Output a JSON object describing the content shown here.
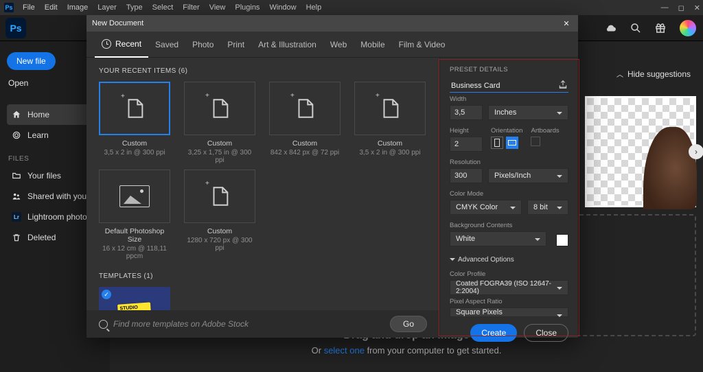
{
  "menubar": {
    "items": [
      "File",
      "Edit",
      "Image",
      "Layer",
      "Type",
      "Select",
      "Filter",
      "View",
      "Plugins",
      "Window",
      "Help"
    ]
  },
  "leftrail": {
    "new_file": "New file",
    "open": "Open",
    "nav": [
      {
        "label": "Home",
        "icon": "home-icon"
      },
      {
        "label": "Learn",
        "icon": "learn-icon"
      }
    ],
    "files_head": "FILES",
    "files": [
      {
        "label": "Your files",
        "icon": "folder-icon"
      },
      {
        "label": "Shared with you",
        "icon": "shared-icon"
      },
      {
        "label": "Lightroom photos",
        "icon": "lightroom-icon"
      },
      {
        "label": "Deleted",
        "icon": "trash-icon"
      }
    ]
  },
  "mainbg": {
    "hide_suggestions": "Hide suggestions",
    "drag_line1": "Drag and drop an image",
    "drag_line2_a": "Or ",
    "drag_link": "select one",
    "drag_line2_b": " from your computer to get started."
  },
  "dialog": {
    "title": "New Document",
    "tabs": [
      "Recent",
      "Saved",
      "Photo",
      "Print",
      "Art & Illustration",
      "Web",
      "Mobile",
      "Film & Video"
    ],
    "recent_head": "YOUR RECENT ITEMS  (6)",
    "recent": [
      {
        "title": "Custom",
        "sub": "3,5 x 2 in @ 300 ppi",
        "kind": "doc",
        "selected": true
      },
      {
        "title": "Custom",
        "sub": "3,25 x 1,75 in @ 300 ppi",
        "kind": "doc"
      },
      {
        "title": "Custom",
        "sub": "842 x 842 px @ 72 ppi",
        "kind": "doc"
      },
      {
        "title": "Custom",
        "sub": "3,5 x 2 in @ 300 ppi",
        "kind": "doc"
      },
      {
        "title": "Default Photoshop Size",
        "sub": "16 x 12 cm @ 118,11 ppcm",
        "kind": "img"
      },
      {
        "title": "Custom",
        "sub": "1280 x 720 px @ 300 ppi",
        "kind": "doc"
      }
    ],
    "templates_head": "TEMPLATES  (1)",
    "template_label": "STUDIO NAME",
    "search_placeholder": "Find more templates on Adobe Stock",
    "go": "Go"
  },
  "details": {
    "head": "PRESET DETAILS",
    "name": "Business Card",
    "width_lbl": "Width",
    "width": "3,5",
    "width_unit": "Inches",
    "height_lbl": "Height",
    "height": "2",
    "orientation_lbl": "Orientation",
    "artboards_lbl": "Artboards",
    "resolution_lbl": "Resolution",
    "resolution": "300",
    "resolution_unit": "Pixels/Inch",
    "color_mode_lbl": "Color Mode",
    "color_mode": "CMYK Color",
    "bit_depth": "8 bit",
    "bg_lbl": "Background Contents",
    "bg": "White",
    "bg_color": "#ffffff",
    "advanced": "Advanced Options",
    "profile_lbl": "Color Profile",
    "profile": "Coated FOGRA39 (ISO 12647-2:2004)",
    "par_lbl": "Pixel Aspect Ratio",
    "par": "Square Pixels",
    "create": "Create",
    "close": "Close"
  }
}
